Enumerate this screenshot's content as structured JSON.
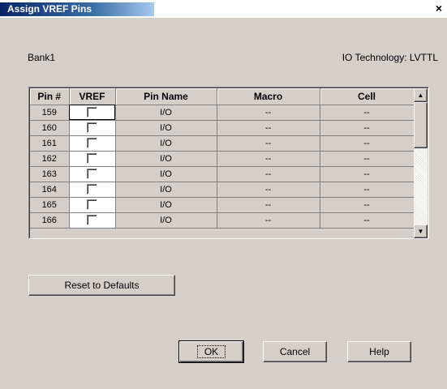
{
  "window": {
    "title": "Assign VREF Pins",
    "close_glyph": "×"
  },
  "bank": {
    "label": "Bank1"
  },
  "io_technology": {
    "text": "IO Technology: LVTTL"
  },
  "grid": {
    "columns": [
      "Pin #",
      "VREF",
      "Pin Name",
      "Macro",
      "Cell"
    ],
    "rows": [
      {
        "pin": "159",
        "vref": false,
        "name": "I/O",
        "macro": "--",
        "cell": "--"
      },
      {
        "pin": "160",
        "vref": false,
        "name": "I/O",
        "macro": "--",
        "cell": "--"
      },
      {
        "pin": "161",
        "vref": false,
        "name": "I/O",
        "macro": "--",
        "cell": "--"
      },
      {
        "pin": "162",
        "vref": false,
        "name": "I/O",
        "macro": "--",
        "cell": "--"
      },
      {
        "pin": "163",
        "vref": false,
        "name": "I/O",
        "macro": "--",
        "cell": "--"
      },
      {
        "pin": "164",
        "vref": false,
        "name": "I/O",
        "macro": "--",
        "cell": "--"
      },
      {
        "pin": "165",
        "vref": false,
        "name": "I/O",
        "macro": "--",
        "cell": "--"
      },
      {
        "pin": "166",
        "vref": false,
        "name": "I/O",
        "macro": "--",
        "cell": "--"
      }
    ],
    "scroll_up_glyph": "▲",
    "scroll_down_glyph": "▼"
  },
  "buttons": {
    "reset": "Reset to Defaults",
    "ok": "OK",
    "cancel": "Cancel",
    "help": "Help"
  }
}
